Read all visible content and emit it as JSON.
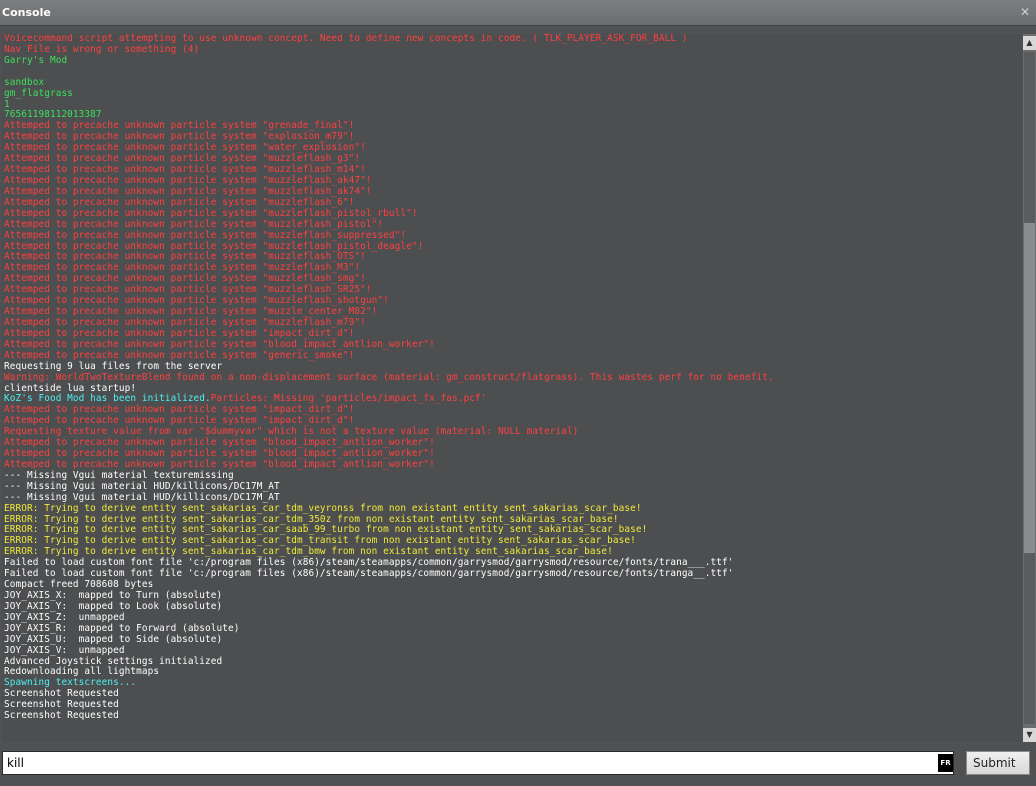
{
  "window": {
    "title": "Console"
  },
  "colors": {
    "red": "#ff4040",
    "green": "#3ee05a",
    "white": "#ffffff",
    "yellow": "#f0ea3a",
    "cyan": "#4ef0f0"
  },
  "console_lines": [
    {
      "color": "red",
      "text": "Voicecommand script attempting to use unknown concept. Need to define new concepts in code. ( TLK_PLAYER_ASK_FOR_BALL )"
    },
    {
      "color": "red",
      "text": "Nav File is wrong or something (4)"
    },
    {
      "color": "green",
      "text": "Garry's Mod"
    },
    {
      "color": "green",
      "text": ""
    },
    {
      "color": "green",
      "text": "sandbox"
    },
    {
      "color": "green",
      "text": "gm_flatgrass"
    },
    {
      "color": "green",
      "text": "1"
    },
    {
      "color": "green",
      "text": "76561198112013387"
    },
    {
      "color": "red",
      "text": "Attemped to precache unknown particle system \"grenade_final\"!"
    },
    {
      "color": "red",
      "text": "Attemped to precache unknown particle system \"explosion_m79\"!"
    },
    {
      "color": "red",
      "text": "Attemped to precache unknown particle system \"water_explosion\"!"
    },
    {
      "color": "red",
      "text": "Attemped to precache unknown particle system \"muzzleflash_g3\"!"
    },
    {
      "color": "red",
      "text": "Attemped to precache unknown particle system \"muzzleflash_m14\"!"
    },
    {
      "color": "red",
      "text": "Attemped to precache unknown particle system \"muzzleflash_ak47\"!"
    },
    {
      "color": "red",
      "text": "Attemped to precache unknown particle system \"muzzleflash_ak74\"!"
    },
    {
      "color": "red",
      "text": "Attemped to precache unknown particle system \"muzzleflash_6\"!"
    },
    {
      "color": "red",
      "text": "Attemped to precache unknown particle system \"muzzleflash_pistol_rbull\"!"
    },
    {
      "color": "red",
      "text": "Attemped to precache unknown particle system \"muzzleflash_pistol\"!"
    },
    {
      "color": "red",
      "text": "Attemped to precache unknown particle system \"muzzleflash_suppressed\"!"
    },
    {
      "color": "red",
      "text": "Attemped to precache unknown particle system \"muzzleflash_pistol_deagle\"!"
    },
    {
      "color": "red",
      "text": "Attemped to precache unknown particle system \"muzzleflash_OTS\"!"
    },
    {
      "color": "red",
      "text": "Attemped to precache unknown particle system \"muzzleflash_M3\"!"
    },
    {
      "color": "red",
      "text": "Attemped to precache unknown particle system \"muzzleflash_smg\"!"
    },
    {
      "color": "red",
      "text": "Attemped to precache unknown particle system \"muzzleflash_SR25\"!"
    },
    {
      "color": "red",
      "text": "Attemped to precache unknown particle system \"muzzleflash_shotgun\"!"
    },
    {
      "color": "red",
      "text": "Attemped to precache unknown particle system \"muzzle_center_M82\"!"
    },
    {
      "color": "red",
      "text": "Attemped to precache unknown particle system \"muzzleflash_m79\"!"
    },
    {
      "color": "red",
      "text": "Attemped to precache unknown particle system \"impact_dirt_d\"!"
    },
    {
      "color": "red",
      "text": "Attemped to precache unknown particle system \"blood_impact_antlion_worker\"!"
    },
    {
      "color": "red",
      "text": "Attemped to precache unknown particle system \"generic_smoke\"!"
    },
    {
      "color": "white",
      "text": "Requesting 9 lua files from the server"
    },
    {
      "color": "red",
      "text": "Warning: WorldTwoTextureBlend found on a non-displacement surface (material: gm_construct/flatgrass). This wastes perf for no benefit."
    },
    {
      "color": "white",
      "text": "clientside lua startup!"
    },
    {
      "parts": [
        {
          "color": "cyan",
          "text": "KoZ's Food Mod has been initialized."
        },
        {
          "color": "red",
          "text": "Particles: Missing 'particles/impact_fx_fas.pcf'"
        }
      ]
    },
    {
      "color": "red",
      "text": "Attemped to precache unknown particle system \"impact_dirt_d\"!"
    },
    {
      "color": "red",
      "text": "Attemped to precache unknown particle system \"impact_dirt_d\"!"
    },
    {
      "color": "red",
      "text": "Requesting texture value from var \"$dummyvar\" which is not a texture value (material: NULL material)"
    },
    {
      "color": "red",
      "text": "Attemped to precache unknown particle system \"blood_impact_antlion_worker\"!"
    },
    {
      "color": "red",
      "text": "Attemped to precache unknown particle system \"blood_impact_antlion_worker\"!"
    },
    {
      "color": "red",
      "text": "Attemped to precache unknown particle system \"blood_impact_antlion_worker\"!"
    },
    {
      "color": "white",
      "text": "--- Missing Vgui material texturemissing"
    },
    {
      "color": "white",
      "text": "--- Missing Vgui material HUD/killicons/DC17M_AT"
    },
    {
      "color": "white",
      "text": "--- Missing Vgui material HUD/killicons/DC17M_AT"
    },
    {
      "color": "yellow",
      "text": "ERROR: Trying to derive entity sent_sakarias_car_tdm_veyronss from non existant entity sent_sakarias_scar_base!"
    },
    {
      "color": "yellow",
      "text": "ERROR: Trying to derive entity sent_sakarias_car_tdm_350z from non existant entity sent_sakarias_scar_base!"
    },
    {
      "color": "yellow",
      "text": "ERROR: Trying to derive entity sent_sakarias_car_saab_99_turbo from non existant entity sent_sakarias_scar_base!"
    },
    {
      "color": "yellow",
      "text": "ERROR: Trying to derive entity sent_sakarias_car_tdm_transit from non existant entity sent_sakarias_scar_base!"
    },
    {
      "color": "yellow",
      "text": "ERROR: Trying to derive entity sent_sakarias_car_tdm_bmw from non existant entity sent_sakarias_scar_base!"
    },
    {
      "color": "white",
      "text": "Failed to load custom font file 'c:/program files (x86)/steam/steamapps/common/garrysmod/garrysmod/resource/fonts/trana___.ttf'"
    },
    {
      "color": "white",
      "text": "Failed to load custom font file 'c:/program files (x86)/steam/steamapps/common/garrysmod/garrysmod/resource/fonts/tranga__.ttf'"
    },
    {
      "color": "white",
      "text": "Compact freed 708608 bytes"
    },
    {
      "color": "white",
      "text": "JOY_AXIS_X:  mapped to Turn (absolute)"
    },
    {
      "color": "white",
      "text": "JOY_AXIS_Y:  mapped to Look (absolute)"
    },
    {
      "color": "white",
      "text": "JOY_AXIS_Z:  unmapped"
    },
    {
      "color": "white",
      "text": "JOY_AXIS_R:  mapped to Forward (absolute)"
    },
    {
      "color": "white",
      "text": "JOY_AXIS_U:  mapped to Side (absolute)"
    },
    {
      "color": "white",
      "text": "JOY_AXIS_V:  unmapped"
    },
    {
      "color": "white",
      "text": "Advanced Joystick settings initialized"
    },
    {
      "color": "white",
      "text": "Redownloading all lightmaps"
    },
    {
      "color": "cyan",
      "text": "Spawning textscreens..."
    },
    {
      "color": "white",
      "text": "Screenshot Requested"
    },
    {
      "color": "white",
      "text": "Screenshot Requested"
    },
    {
      "color": "white",
      "text": "Screenshot Requested"
    }
  ],
  "input": {
    "value": "kill",
    "lang_badge": "FR"
  },
  "buttons": {
    "submit_label": "Submit"
  },
  "scrollbar": {
    "position_fraction": 0.5
  },
  "icons": {
    "close": "close-icon",
    "scroll_up": "scroll-up-arrow-icon",
    "scroll_down": "scroll-down-arrow-icon"
  }
}
